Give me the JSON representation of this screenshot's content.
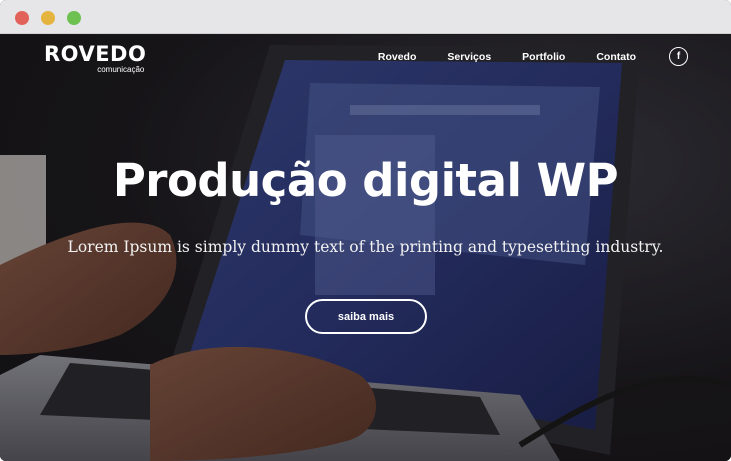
{
  "browser": {
    "buttons": [
      "close",
      "minimize",
      "maximize"
    ],
    "colors": {
      "close": "#e2625a",
      "minimize": "#e5b43f",
      "maximize": "#6cc150"
    }
  },
  "header": {
    "logo": {
      "main": "ROVEDO",
      "sub": "comunicação"
    },
    "nav": [
      "Rovedo",
      "Serviços",
      "Portfolio",
      "Contato"
    ],
    "social_icon": "facebook-icon",
    "social_glyph": "f"
  },
  "hero": {
    "title": "Produção digital WP",
    "subtitle": "Lorem Ipsum is simply dummy text of the printing and typesetting industry.",
    "cta_label": "saiba mais",
    "background_icon": "laptop-typing-photo"
  }
}
